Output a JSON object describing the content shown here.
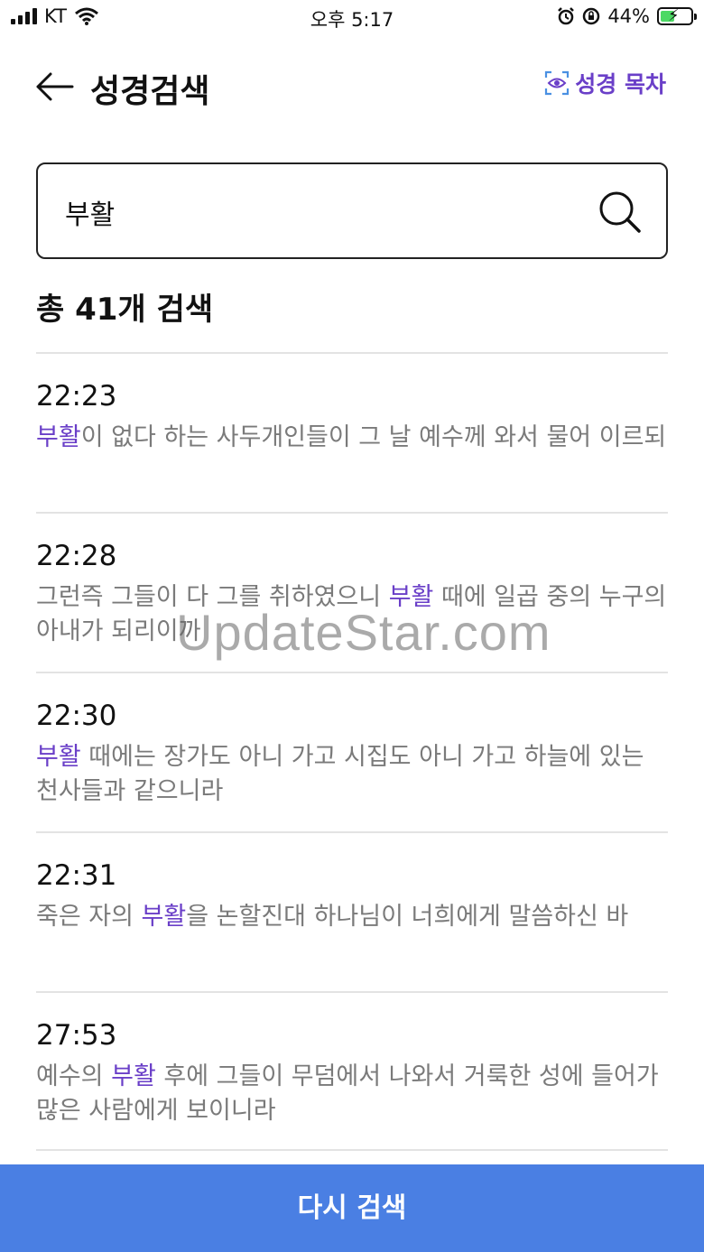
{
  "status": {
    "carrier": "KT",
    "time": "오후 5:17",
    "battery": "44%",
    "icons": [
      "signal-icon",
      "wifi-icon",
      "alarm-icon",
      "orientation-lock-icon",
      "battery-charging-icon"
    ]
  },
  "header": {
    "title": "성경검색",
    "toc_label": "성경 목차"
  },
  "search": {
    "value": "부활",
    "placeholder": ""
  },
  "summary": "총 41개 검색",
  "results": [
    {
      "ref": "22:23",
      "before": "",
      "keyword": "부활",
      "after": "이 없다 하는 사두개인들이 그 날 예수께 와서 물어 이르되"
    },
    {
      "ref": "22:28",
      "before": "그런즉 그들이 다 그를 취하였으니 ",
      "keyword": "부활",
      "after": " 때에 일곱 중의 누구의 아내가 되리이까"
    },
    {
      "ref": "22:30",
      "before": "",
      "keyword": "부활",
      "after": " 때에는 장가도 아니 가고 시집도 아니 가고 하늘에 있는 천사들과 같으니라"
    },
    {
      "ref": "22:31",
      "before": "죽은 자의 ",
      "keyword": "부활",
      "after": "을 논할진대 하나님이 너희에게 말씀하신 바"
    },
    {
      "ref": "27:53",
      "before": "예수의 ",
      "keyword": "부활",
      "after": " 후에 그들이 무덤에서 나와서 거룩한 성에 들어가 많은 사람에게 보이니라"
    }
  ],
  "action_button": "다시 검색",
  "watermark": "UpdateStar.com",
  "colors": {
    "accent": "#6a3fc8",
    "button": "#4a7fe3"
  }
}
